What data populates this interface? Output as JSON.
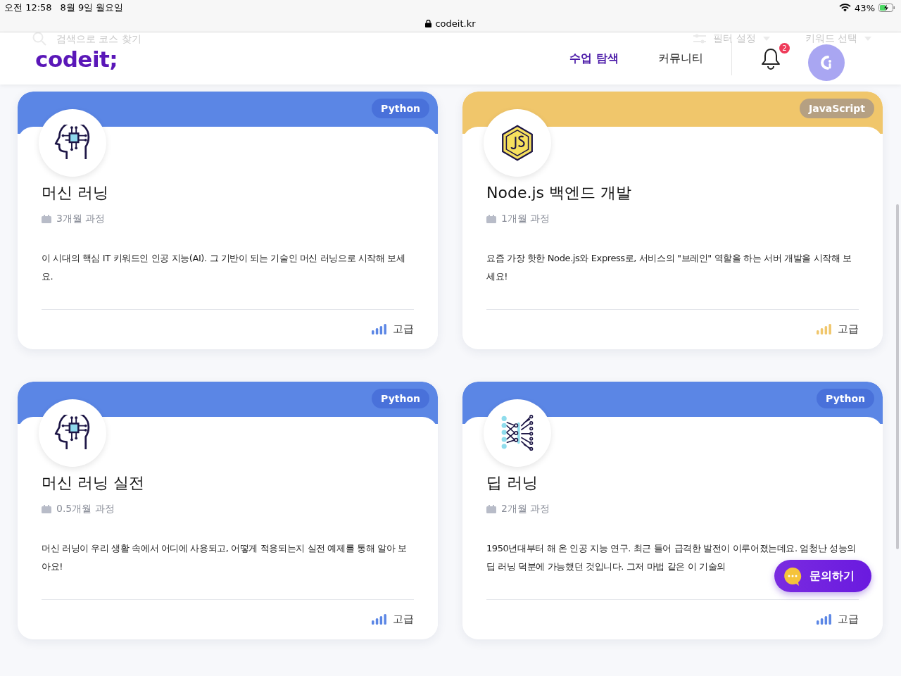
{
  "status_bar": {
    "time": "오전 12:58",
    "date": "8월 9일 월요일",
    "battery": "43%"
  },
  "address_bar": {
    "url": "codeit.kr"
  },
  "behind_header": {
    "search_placeholder": "검색으로 코스 찾기",
    "filter": "필터 설정",
    "keyword": "키워드 선택"
  },
  "header": {
    "logo": "codeit;",
    "nav": [
      {
        "label": "수업 탐색",
        "selected": true
      },
      {
        "label": "커뮤니티",
        "selected": false
      }
    ],
    "notifications": "2"
  },
  "courses": [
    {
      "tag": "Python",
      "color": "#5b86e5",
      "title": "머신 러닝",
      "duration": "3개월 과정",
      "description": "이 시대의 핵심 IT 키워드인 인공 지능(AI). 그 기반이 되는 기술인 머신 러닝으로 시작해 보세요.",
      "level": "고급"
    },
    {
      "tag": "JavaScript",
      "color": "#f0c66b",
      "title": "Node.js 백엔드 개발",
      "duration": "1개월 과정",
      "description": "요즘 가장 핫한 Node.js와 Express로, 서비스의 \"브레인\" 역할을 하는 서버 개발을 시작해 보세요!",
      "level": "고급"
    },
    {
      "tag": "Python",
      "color": "#5b86e5",
      "title": "머신 러닝 실전",
      "duration": "0.5개월 과정",
      "description": "머신 러닝이 우리 생활 속에서 어디에 사용되고, 어떻게 적용되는지 실전 예제를 통해 알아 보아요!",
      "level": "고급"
    },
    {
      "tag": "Python",
      "color": "#5b86e5",
      "title": "딥 러닝",
      "duration": "2개월 과정",
      "description": "1950년대부터 해 온 인공 지능 연구. 최근 들어 급격한 발전이 이루어졌는데요. 엄청난 성능의 딥 러닝 덕분에 가능했던 것입니다. 그저 마법 같은 이 기술의",
      "level": "고급"
    }
  ],
  "chat_button": {
    "label": "문의하기"
  }
}
